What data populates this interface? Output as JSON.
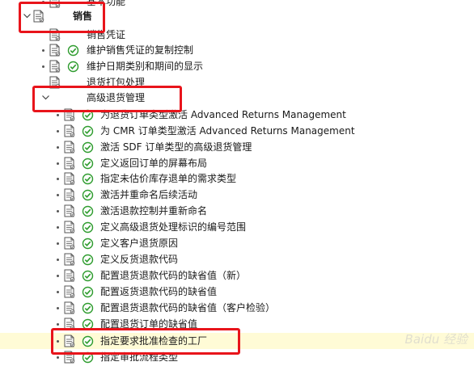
{
  "rows": [
    {
      "label": "基本功能",
      "level": 1,
      "node": "doc",
      "exec": false
    },
    {
      "label": "销售",
      "level": 0,
      "node": "folder",
      "expanded": true,
      "exec": false
    },
    {
      "label": "销售凭证",
      "level": 1,
      "node": "folder",
      "exec": false
    },
    {
      "label": "维护销售凭证的复制控制",
      "level": 1,
      "node": "doc",
      "exec": true
    },
    {
      "label": "维护日期类别和期间的显示",
      "level": 1,
      "node": "doc",
      "exec": true
    },
    {
      "label": "退货打包处理",
      "level": 1,
      "node": "folder",
      "exec": false
    },
    {
      "label": "高级退货管理",
      "level": 1,
      "node": "folder",
      "expanded": true,
      "exec": false
    },
    {
      "label": "为退货订单类型激活 Advanced Returns Management",
      "level": 2,
      "node": "doc",
      "exec": true
    },
    {
      "label": "为 CMR 订单类型激活 Advanced Returns Management",
      "level": 2,
      "node": "doc",
      "exec": true
    },
    {
      "label": "激活 SDF 订单类型的高级退货管理",
      "level": 2,
      "node": "doc",
      "exec": true
    },
    {
      "label": "定义返回订单的屏幕布局",
      "level": 2,
      "node": "doc",
      "exec": true
    },
    {
      "label": "指定未估价库存退单的需求类型",
      "level": 2,
      "node": "doc",
      "exec": true
    },
    {
      "label": "激活并重命名后续活动",
      "level": 2,
      "node": "doc",
      "exec": true
    },
    {
      "label": "激活退款控制并重新命名",
      "level": 2,
      "node": "doc",
      "exec": true
    },
    {
      "label": "定义高级退货处理标识的编号范围",
      "level": 2,
      "node": "doc",
      "exec": true
    },
    {
      "label": "定义客户退货原因",
      "level": 2,
      "node": "doc",
      "exec": true
    },
    {
      "label": "定义反货退款代码",
      "level": 2,
      "node": "doc",
      "exec": true
    },
    {
      "label": "配置退货退款代码的缺省值（新）",
      "level": 2,
      "node": "doc",
      "exec": true
    },
    {
      "label": "配置返货退款代码的缺省值",
      "level": 2,
      "node": "doc",
      "exec": true
    },
    {
      "label": "配置退货退款代码的缺省值（客户检验）",
      "level": 2,
      "node": "doc",
      "exec": true
    },
    {
      "label": "配置退货订单的缺省值",
      "level": 2,
      "node": "doc",
      "exec": true
    },
    {
      "label": "指定要求批准检查的工厂",
      "level": 2,
      "node": "doc",
      "exec": true,
      "selected": true
    },
    {
      "label": "指定审批流程类型",
      "level": 2,
      "node": "doc",
      "exec": true
    }
  ],
  "colors": {
    "highlight": "#e8141b",
    "selected_row": "#fffbd6",
    "exec_icon": "#2e9c2e"
  },
  "watermark": "Baidu 经验"
}
